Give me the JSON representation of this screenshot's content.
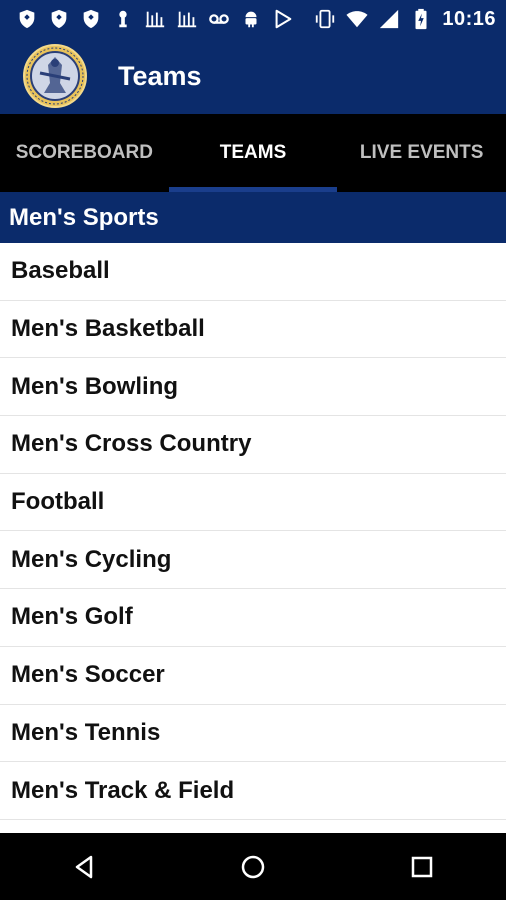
{
  "status_bar": {
    "time": "10:16",
    "left_icons": [
      "shield-icon",
      "shield-icon",
      "shield-icon",
      "keyhole-icon",
      "chart-icon",
      "chart-icon",
      "voicemail-icon",
      "android-icon",
      "play-icon"
    ],
    "right_icons": [
      "vibrate-icon",
      "wifi-icon",
      "signal-icon",
      "battery-icon"
    ]
  },
  "app_bar": {
    "title": "Teams",
    "logo": "school-seal-logo"
  },
  "tabs": [
    {
      "label": "SCOREBOARD",
      "active": false
    },
    {
      "label": "TEAMS",
      "active": true
    },
    {
      "label": "LIVE EVENTS",
      "active": false
    }
  ],
  "section": {
    "title": "Men's Sports",
    "items": [
      "Baseball",
      "Men's Basketball",
      "Men's Bowling",
      "Men's Cross Country",
      "Football",
      "Men's Cycling",
      "Men's Golf",
      "Men's Soccer",
      "Men's Tennis",
      "Men's Track & Field"
    ]
  },
  "colors": {
    "brand_navy": "#0b2b6b",
    "tab_bar": "#000000",
    "tab_indicator": "#1a3e8c"
  },
  "nav_bar": {
    "buttons": [
      "back-icon",
      "home-icon",
      "recents-icon"
    ]
  }
}
